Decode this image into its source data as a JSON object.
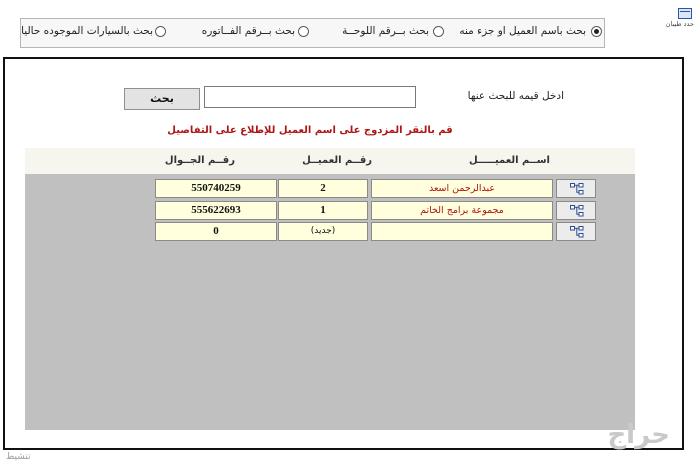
{
  "header": {
    "corner_label": "حدد طيبان",
    "search_modes": [
      {
        "label": "بحث باسم العميل او جزء منه",
        "selected": true
      },
      {
        "label": "بحث بــرقم اللوحــة",
        "selected": false
      },
      {
        "label": "بحث بــرقم الفــاتوره",
        "selected": false
      },
      {
        "label": "بحث بالسيارات الموجوده حاليا",
        "selected": false
      }
    ]
  },
  "search": {
    "label": "ادخل قيمه للبحث عنها",
    "value": "",
    "button_label": "بحث"
  },
  "instruction": "قم بالنقر المزدوج على اسم العميل للإطلاع على التفاصيل",
  "table": {
    "headers": {
      "name": "اســم العميـــــل",
      "number": "رقــم العميــل",
      "mobile": "رقــم الجــوال"
    },
    "rows": [
      {
        "name": "عبدالرحمن اسعد",
        "number": "2",
        "mobile": "550740259"
      },
      {
        "name": "مجموعة برامج الخاتم",
        "number": "1",
        "mobile": "555622693"
      },
      {
        "name": "",
        "number": "(جديد)",
        "mobile": "0"
      }
    ]
  },
  "watermark": "حراج",
  "bottom_text": "تنشيط"
}
